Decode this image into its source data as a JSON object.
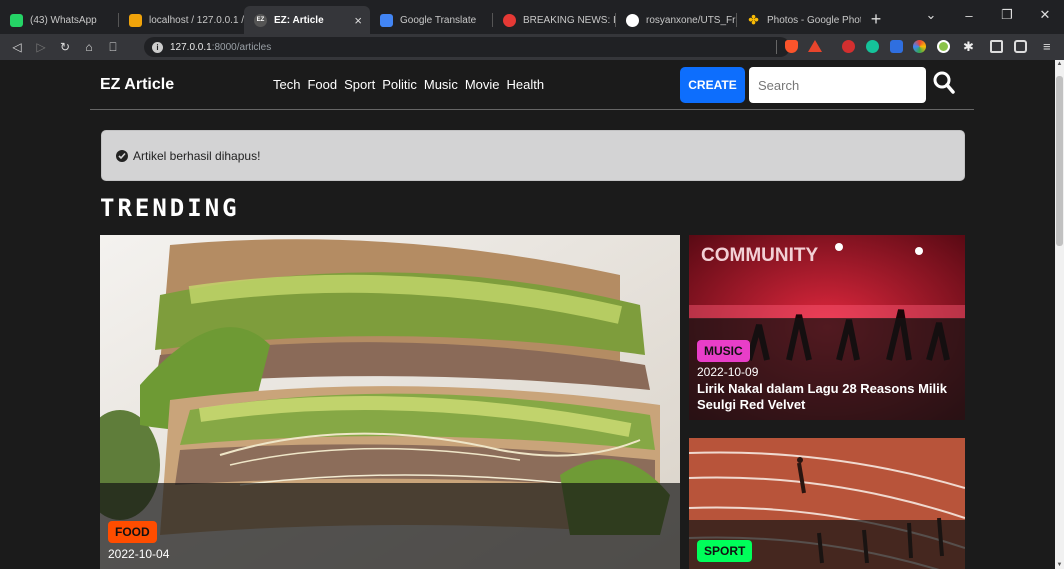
{
  "browser": {
    "tabs": [
      {
        "label": "(43) WhatsApp",
        "color": "#25d366",
        "glyph": "W"
      },
      {
        "label": "localhost / 127.0.0.1 / ...",
        "color": "#f0a30a",
        "glyph": "P"
      },
      {
        "label": "EZ: Article",
        "color": "#4a4a4a",
        "glyph": "EZ"
      },
      {
        "label": "Google Translate",
        "color": "#4285f4",
        "glyph": "G"
      },
      {
        "label": "BREAKING NEWS: Indo",
        "color": "#e53935",
        "glyph": "B"
      },
      {
        "label": "rosyanxone/UTS_Fram",
        "color": "#ffffff",
        "glyph": "O"
      },
      {
        "label": "Photos - Google Photo",
        "color": "#fbbc04",
        "glyph": "✤"
      }
    ],
    "active_tab_close": "×",
    "new_tab": "+",
    "url_host": "127.0.0.1",
    "url_path": ":8000/articles"
  },
  "nav": {
    "brand": "EZ Article",
    "menu": [
      "Tech",
      "Food",
      "Sport",
      "Politic",
      "Music",
      "Movie",
      "Health"
    ],
    "create_label": "CREATE",
    "search_placeholder": "Search"
  },
  "alert": {
    "text": "Artikel berhasil dihapus!"
  },
  "section_title": "TRENDING",
  "articles": [
    {
      "category": "FOOD",
      "badge_color": "#ff4d00",
      "date": "2022-10-04",
      "title": ""
    },
    {
      "category": "MUSIC",
      "badge_color": "#e83ec8",
      "date": "2022-10-09",
      "title": "Lirik Nakal dalam Lagu 28 Reasons Milik Seulgi Red Velvet",
      "image_text": "COMMUNITY"
    },
    {
      "category": "SPORT",
      "badge_color": "#00ff5a",
      "date": "",
      "title": ""
    }
  ]
}
